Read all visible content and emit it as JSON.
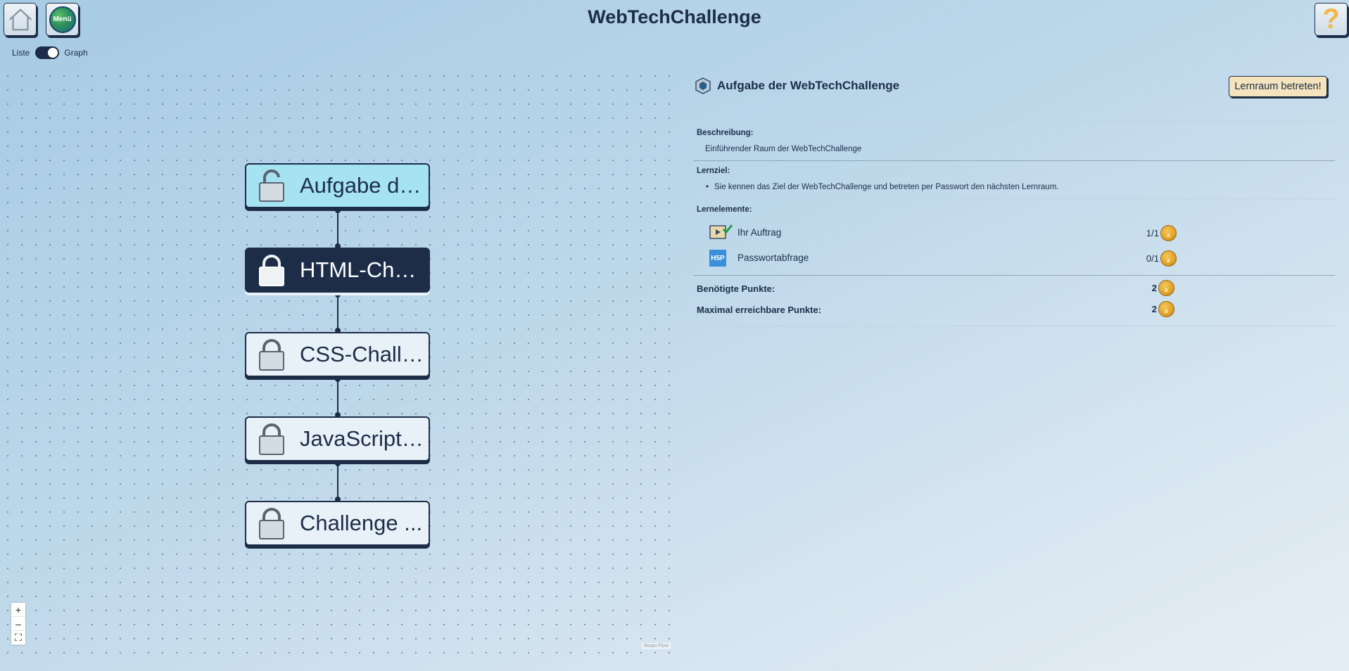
{
  "app": {
    "title": "WebTechChallenge"
  },
  "toolbar": {
    "menu_label": "Menü"
  },
  "view_toggle": {
    "left_label": "Liste",
    "right_label": "Graph",
    "active": "Graph"
  },
  "graph": {
    "nodes": [
      {
        "label": "Aufgabe de...",
        "state": "unlocked"
      },
      {
        "label": "HTML-Chal...",
        "state": "locked-selected"
      },
      {
        "label": "CSS-Challe...",
        "state": "locked"
      },
      {
        "label": "JavaScript-...",
        "state": "locked"
      },
      {
        "label": "Challenge ...",
        "state": "locked"
      }
    ],
    "zoom_controls": {
      "zoom_in": "+",
      "zoom_out": "–",
      "fit": "⛶"
    },
    "attribution": "React Flow"
  },
  "details": {
    "title": "Aufgabe der WebTechChallenge",
    "enter_button": "Lernraum betreten!",
    "description_label": "Beschreibung:",
    "description": "Einführender Raum der WebTechChallenge",
    "goal_label": "Lernziel:",
    "goal_items": [
      "Sie kennen das Ziel der WebTechChallenge und betreten per Passwort den nächsten Lernraum."
    ],
    "elements_label": "Lernelemente:",
    "elements": [
      {
        "name": "Ihr Auftrag",
        "score": "1/1",
        "icon": "video-icon",
        "completed": true
      },
      {
        "name": "Passwortabfrage",
        "score": "0/1",
        "icon": "h5p-icon",
        "completed": false
      }
    ],
    "required_points_label": "Benötigte Punkte:",
    "required_points": "2",
    "max_points_label": "Maximal erreichbare Punkte:",
    "max_points": "2"
  },
  "colors": {
    "navy": "#1d2d48",
    "unlocked": "#a5e3f3",
    "button": "#f4e3bd",
    "coin": "#e0a329"
  }
}
